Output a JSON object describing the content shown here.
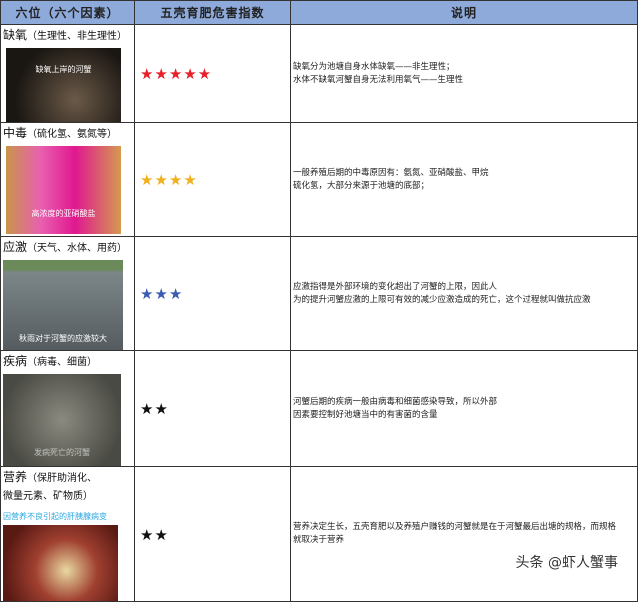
{
  "header": {
    "col1": "六位（六个因素）",
    "col2": "五壳育肥危害指数",
    "col3": "说明"
  },
  "rows": [
    {
      "name": "缺氧",
      "sub": "（生理性、非生理性）",
      "caption": "缺氧上岸的河蟹",
      "stars": "★★★★★",
      "star_color": "#e8202a",
      "desc1": "缺氧分为池塘自身水体缺氧——非生理性；",
      "desc2": "水体不缺氧河蟹自身无法利用氧气——生理性"
    },
    {
      "name": "中毒",
      "sub": "（硫化氢、氨氮等）",
      "caption": "高浓度的亚硝酸盐",
      "stars": "★★★★",
      "star_color": "#f2b01e",
      "desc1": "一般养殖后期的中毒原因有：氨氮、亚硝酸盐、甲烷",
      "desc2": "硫化氢，大部分来源于池塘的底部；"
    },
    {
      "name": "应激",
      "sub": "（天气、水体、用药）",
      "caption": "秋雨对于河蟹的应激较大",
      "stars": "★★★",
      "star_color": "#3a5bb0",
      "desc1": "应激指得是外部环境的变化超出了河蟹的上限，因此人",
      "desc2": "为的提升河蟹应激的上限可有效的减少应激造成的死亡，这个过程就叫做抗应激"
    },
    {
      "name": "疾病",
      "sub": "（病毒、细菌）",
      "caption": "发病死亡的河蟹",
      "stars": "★★",
      "star_color": "#111111",
      "desc1": "河蟹后期的疾病一般由病毒和细菌感染导致，所以外部",
      "desc2": "因素要控制好池塘当中的有害菌的含量"
    },
    {
      "name": "营养",
      "sub": "（保肝助消化、",
      "sub2": "微量元素、矿物质）",
      "note": "因营养不良引起的肝胰腺病变",
      "stars": "★★",
      "star_color": "#111111",
      "desc1": "营养决定生长，五壳育肥以及养殖户赚钱的河蟹就是在于河蟹最后出塘的规格，而规格",
      "desc2": "就取决于营养"
    }
  ],
  "watermark": "头条 @虾人蟹事"
}
